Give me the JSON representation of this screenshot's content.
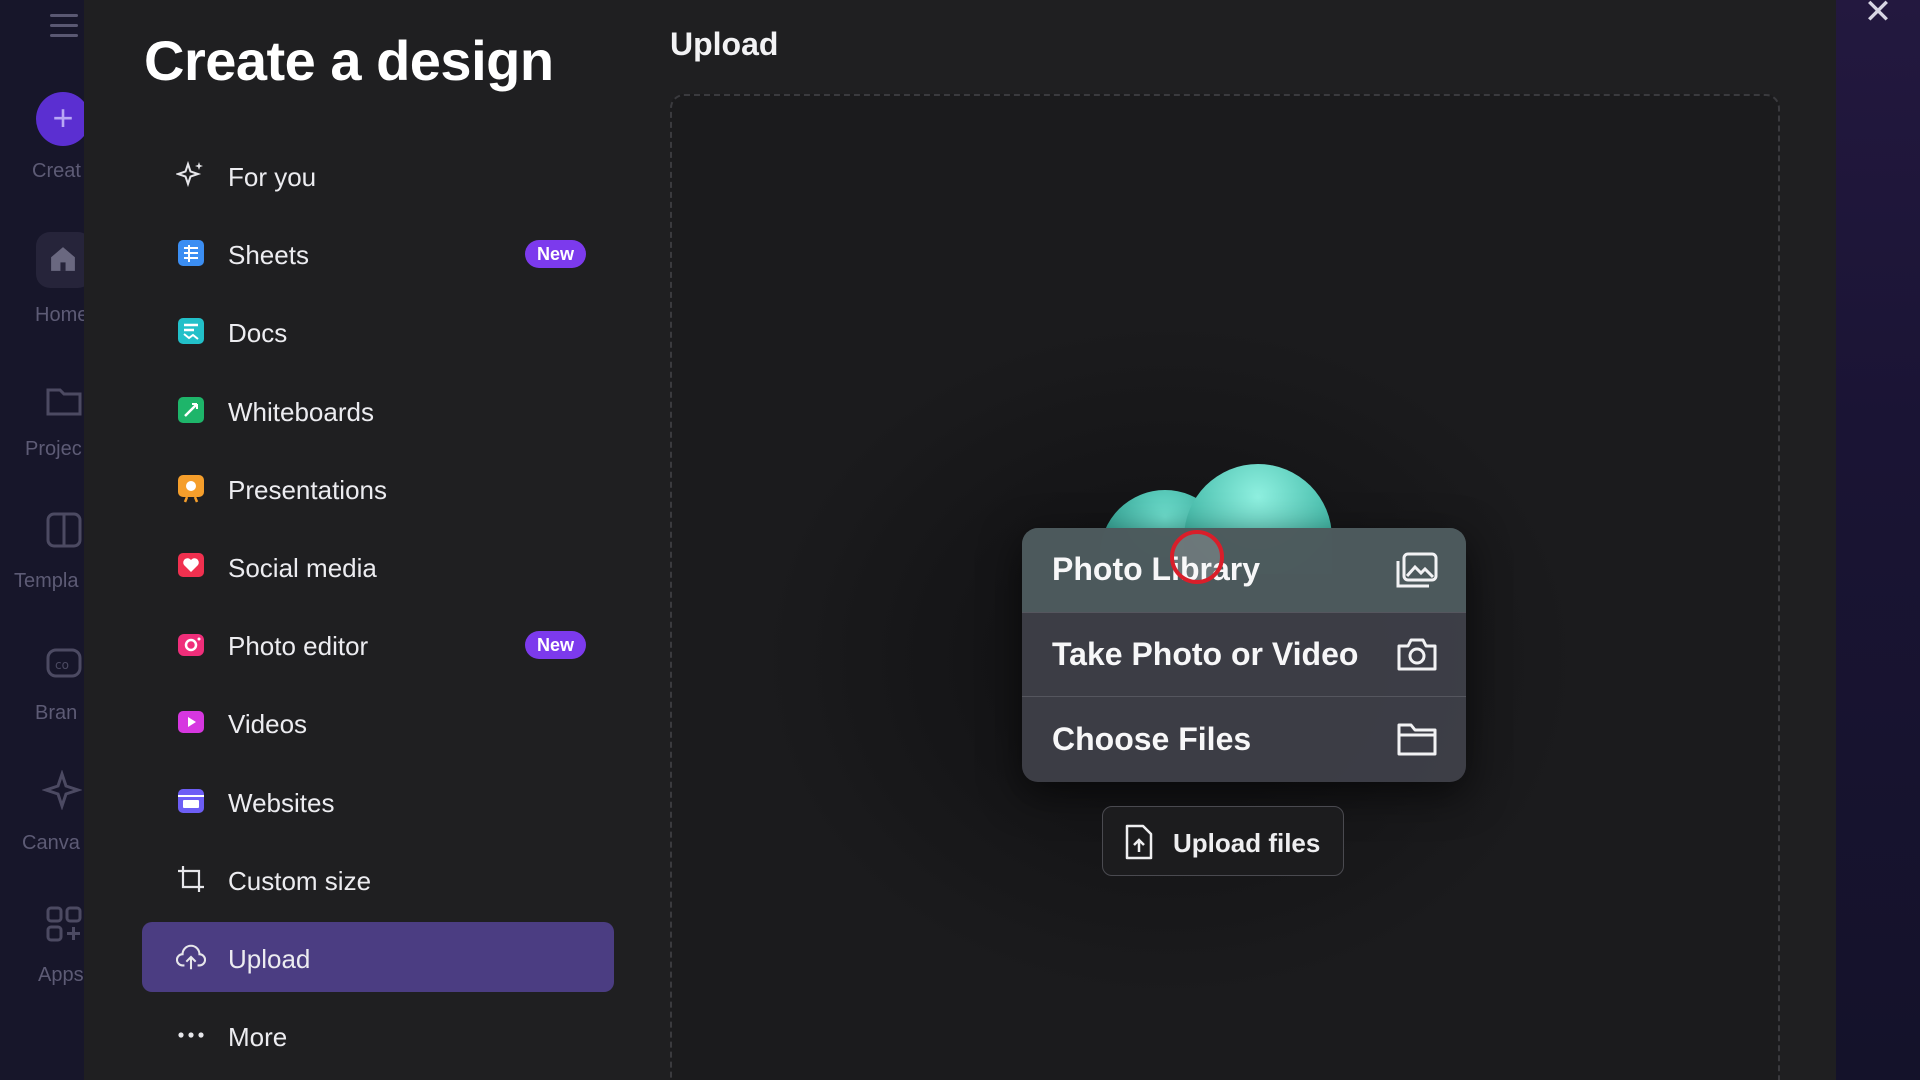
{
  "rail": {
    "items": [
      {
        "label": "Creat"
      },
      {
        "label": "Home"
      },
      {
        "label": "Projec"
      },
      {
        "label": "Templa"
      },
      {
        "label": "Bran"
      },
      {
        "label": "Canva"
      },
      {
        "label": "Apps"
      }
    ]
  },
  "modal": {
    "title": "Create a design",
    "close_icon": "close-icon"
  },
  "nav": {
    "items": [
      {
        "label": "For you",
        "icon": "sparkles-icon"
      },
      {
        "label": "Sheets",
        "icon": "sheets-icon",
        "badge": "New"
      },
      {
        "label": "Docs",
        "icon": "docs-icon"
      },
      {
        "label": "Whiteboards",
        "icon": "whiteboard-icon"
      },
      {
        "label": "Presentations",
        "icon": "presentation-icon"
      },
      {
        "label": "Social media",
        "icon": "heart-icon"
      },
      {
        "label": "Photo editor",
        "icon": "camera-icon",
        "badge": "New"
      },
      {
        "label": "Videos",
        "icon": "video-icon"
      },
      {
        "label": "Websites",
        "icon": "website-icon"
      },
      {
        "label": "Custom size",
        "icon": "crop-icon"
      },
      {
        "label": "Upload",
        "icon": "cloud-upload-icon",
        "active": true
      },
      {
        "label": "More",
        "icon": "more-icon"
      }
    ]
  },
  "upload": {
    "heading": "Upload",
    "menu": [
      {
        "label": "Photo Library",
        "icon": "photo-library-icon"
      },
      {
        "label": "Take Photo or Video",
        "icon": "camera-icon"
      },
      {
        "label": "Choose Files",
        "icon": "folder-icon"
      }
    ],
    "upload_button": "Upload files"
  },
  "colors": {
    "active_nav_bg": "#4b3d82",
    "badge_bg": "#7c3aed",
    "modal_bg": "#1f1f21"
  }
}
